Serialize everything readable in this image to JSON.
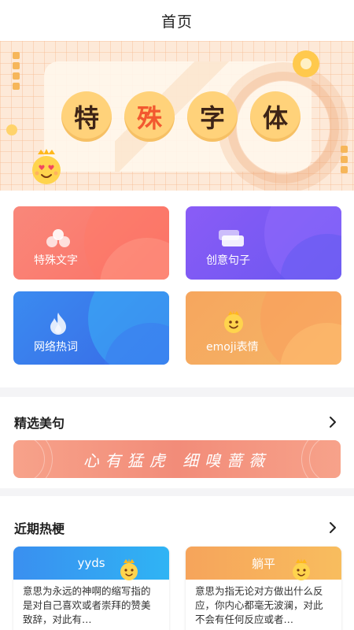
{
  "header": {
    "title": "首页"
  },
  "banner": {
    "chars": [
      "特",
      "殊",
      "字",
      "体"
    ]
  },
  "tools": [
    {
      "label": "特殊文字",
      "icon": "cloud-icon",
      "color": "#fb7266"
    },
    {
      "label": "创意句子",
      "icon": "cards-icon",
      "color": "#7a57f3"
    },
    {
      "label": "网络热词",
      "icon": "flame-icon",
      "color": "#3a7aeb"
    },
    {
      "label": "emoji表情",
      "icon": "emoji-crown-icon",
      "color": "#f5ac60"
    }
  ],
  "featured": {
    "title": "精选美句",
    "quote": "心有猛虎 细嗅蔷薇"
  },
  "hot": {
    "title": "近期热梗",
    "items": [
      {
        "title": "yyds",
        "desc": "意思为永远的神啊的缩写指的是对自己喜欢或者崇拜的赞美致辞，对此有…"
      },
      {
        "title": "躺平",
        "desc": "意思为指无论对方做出什么反应，你内心都毫无波澜，对此不会有任何反应或者…"
      }
    ]
  }
}
